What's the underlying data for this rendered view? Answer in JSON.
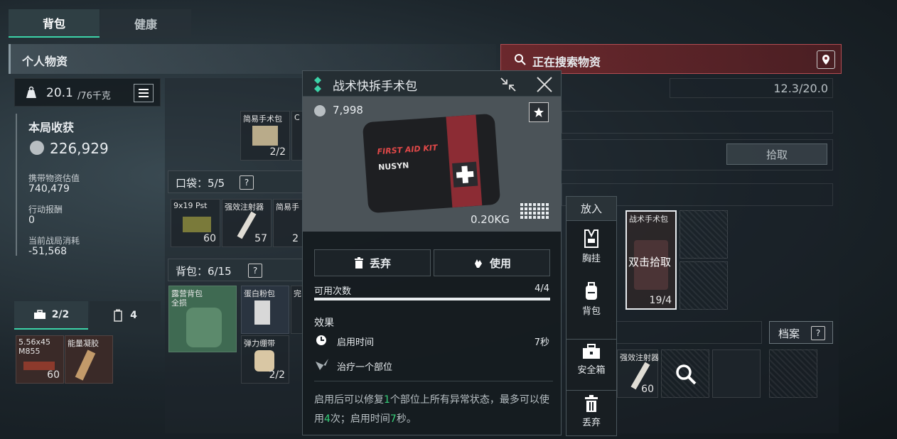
{
  "tabs": [
    {
      "label": "背包",
      "active": true
    },
    {
      "label": "健康",
      "active": false
    }
  ],
  "left_panel": {
    "title": "个人物资",
    "weight": {
      "current": "20.1",
      "max": "/76千克"
    },
    "earnings": {
      "title": "本局收获",
      "value": "226,929",
      "carry_label": "携带物资估值",
      "carry_value": "740,479",
      "reward_label": "行动报酬",
      "reward_value": "0",
      "cost_label": "当前战局消耗",
      "cost_value": "-51,568"
    },
    "bottom_tabs": [
      {
        "label": "2/2",
        "icon": "toolbox-icon"
      },
      {
        "label": "4",
        "icon": "canister-icon"
      }
    ],
    "safe_items": [
      {
        "name": "5.56x45 M855",
        "count": "60"
      },
      {
        "name": "能量凝胶",
        "count": ""
      }
    ]
  },
  "gear": {
    "top_items": [
      {
        "name": "简易手术包",
        "count": "2/2"
      },
      {
        "name": "C",
        "count": ""
      }
    ],
    "pocket_label": "口袋：5/5",
    "pocket_items": [
      {
        "name": "9x19 Pst",
        "count": "60"
      },
      {
        "name": "强效注射器",
        "count": "57"
      },
      {
        "name": "简易手",
        "count": "2"
      }
    ],
    "backpack_label": "背包：6/15",
    "backpack_items": [
      {
        "name": "露营背包",
        "sub": "全损"
      },
      {
        "name": "蛋白粉包",
        "count": ""
      },
      {
        "name": "完",
        "count": ""
      },
      {
        "name": "弹力绷带",
        "count": "2/2"
      }
    ]
  },
  "right_panel": {
    "title": "正在搜索物资",
    "capacity": "12.3/20.0",
    "pickup_label": "拾取",
    "archive_label": "档案",
    "loot_item": {
      "name": "战术手术包",
      "hint": "双击拾取",
      "count": "19/4"
    },
    "injector": {
      "name": "强效注射器",
      "count": "60"
    }
  },
  "popup": {
    "title": "战术快拆手术包",
    "price": "7,998",
    "weight": "0.20KG",
    "image_text_1": "FIRST AID KIT",
    "image_text_2": "NUSYN",
    "discard_label": "丢弃",
    "use_label": "使用",
    "uses_label": "可用次数",
    "uses_value": "4/4",
    "uses_fraction": 1.0,
    "effects_title": "效果",
    "effect_time_label": "启用时间",
    "effect_time_value": "7秒",
    "effect_heal_label": "治疗一个部位",
    "desc_1": "启用后可以修复",
    "desc_n1": "1",
    "desc_2": "个部位上所有异常状态，最多可以使用",
    "desc_n2": "4",
    "desc_3": "次；启用时间",
    "desc_n3": "7",
    "desc_4": "秒。"
  },
  "action_menu": {
    "header": "放入",
    "items": [
      {
        "label": "胸挂",
        "icon": "chest-rig-icon"
      },
      {
        "label": "背包",
        "icon": "backpack-icon"
      },
      {
        "label": "安全箱",
        "icon": "safe-box-icon"
      },
      {
        "label": "丢弃",
        "icon": "trash-icon"
      }
    ]
  },
  "colors": {
    "accent": "#3cd3a8",
    "danger": "#b34c52",
    "highlight_num": "#36d17a"
  }
}
